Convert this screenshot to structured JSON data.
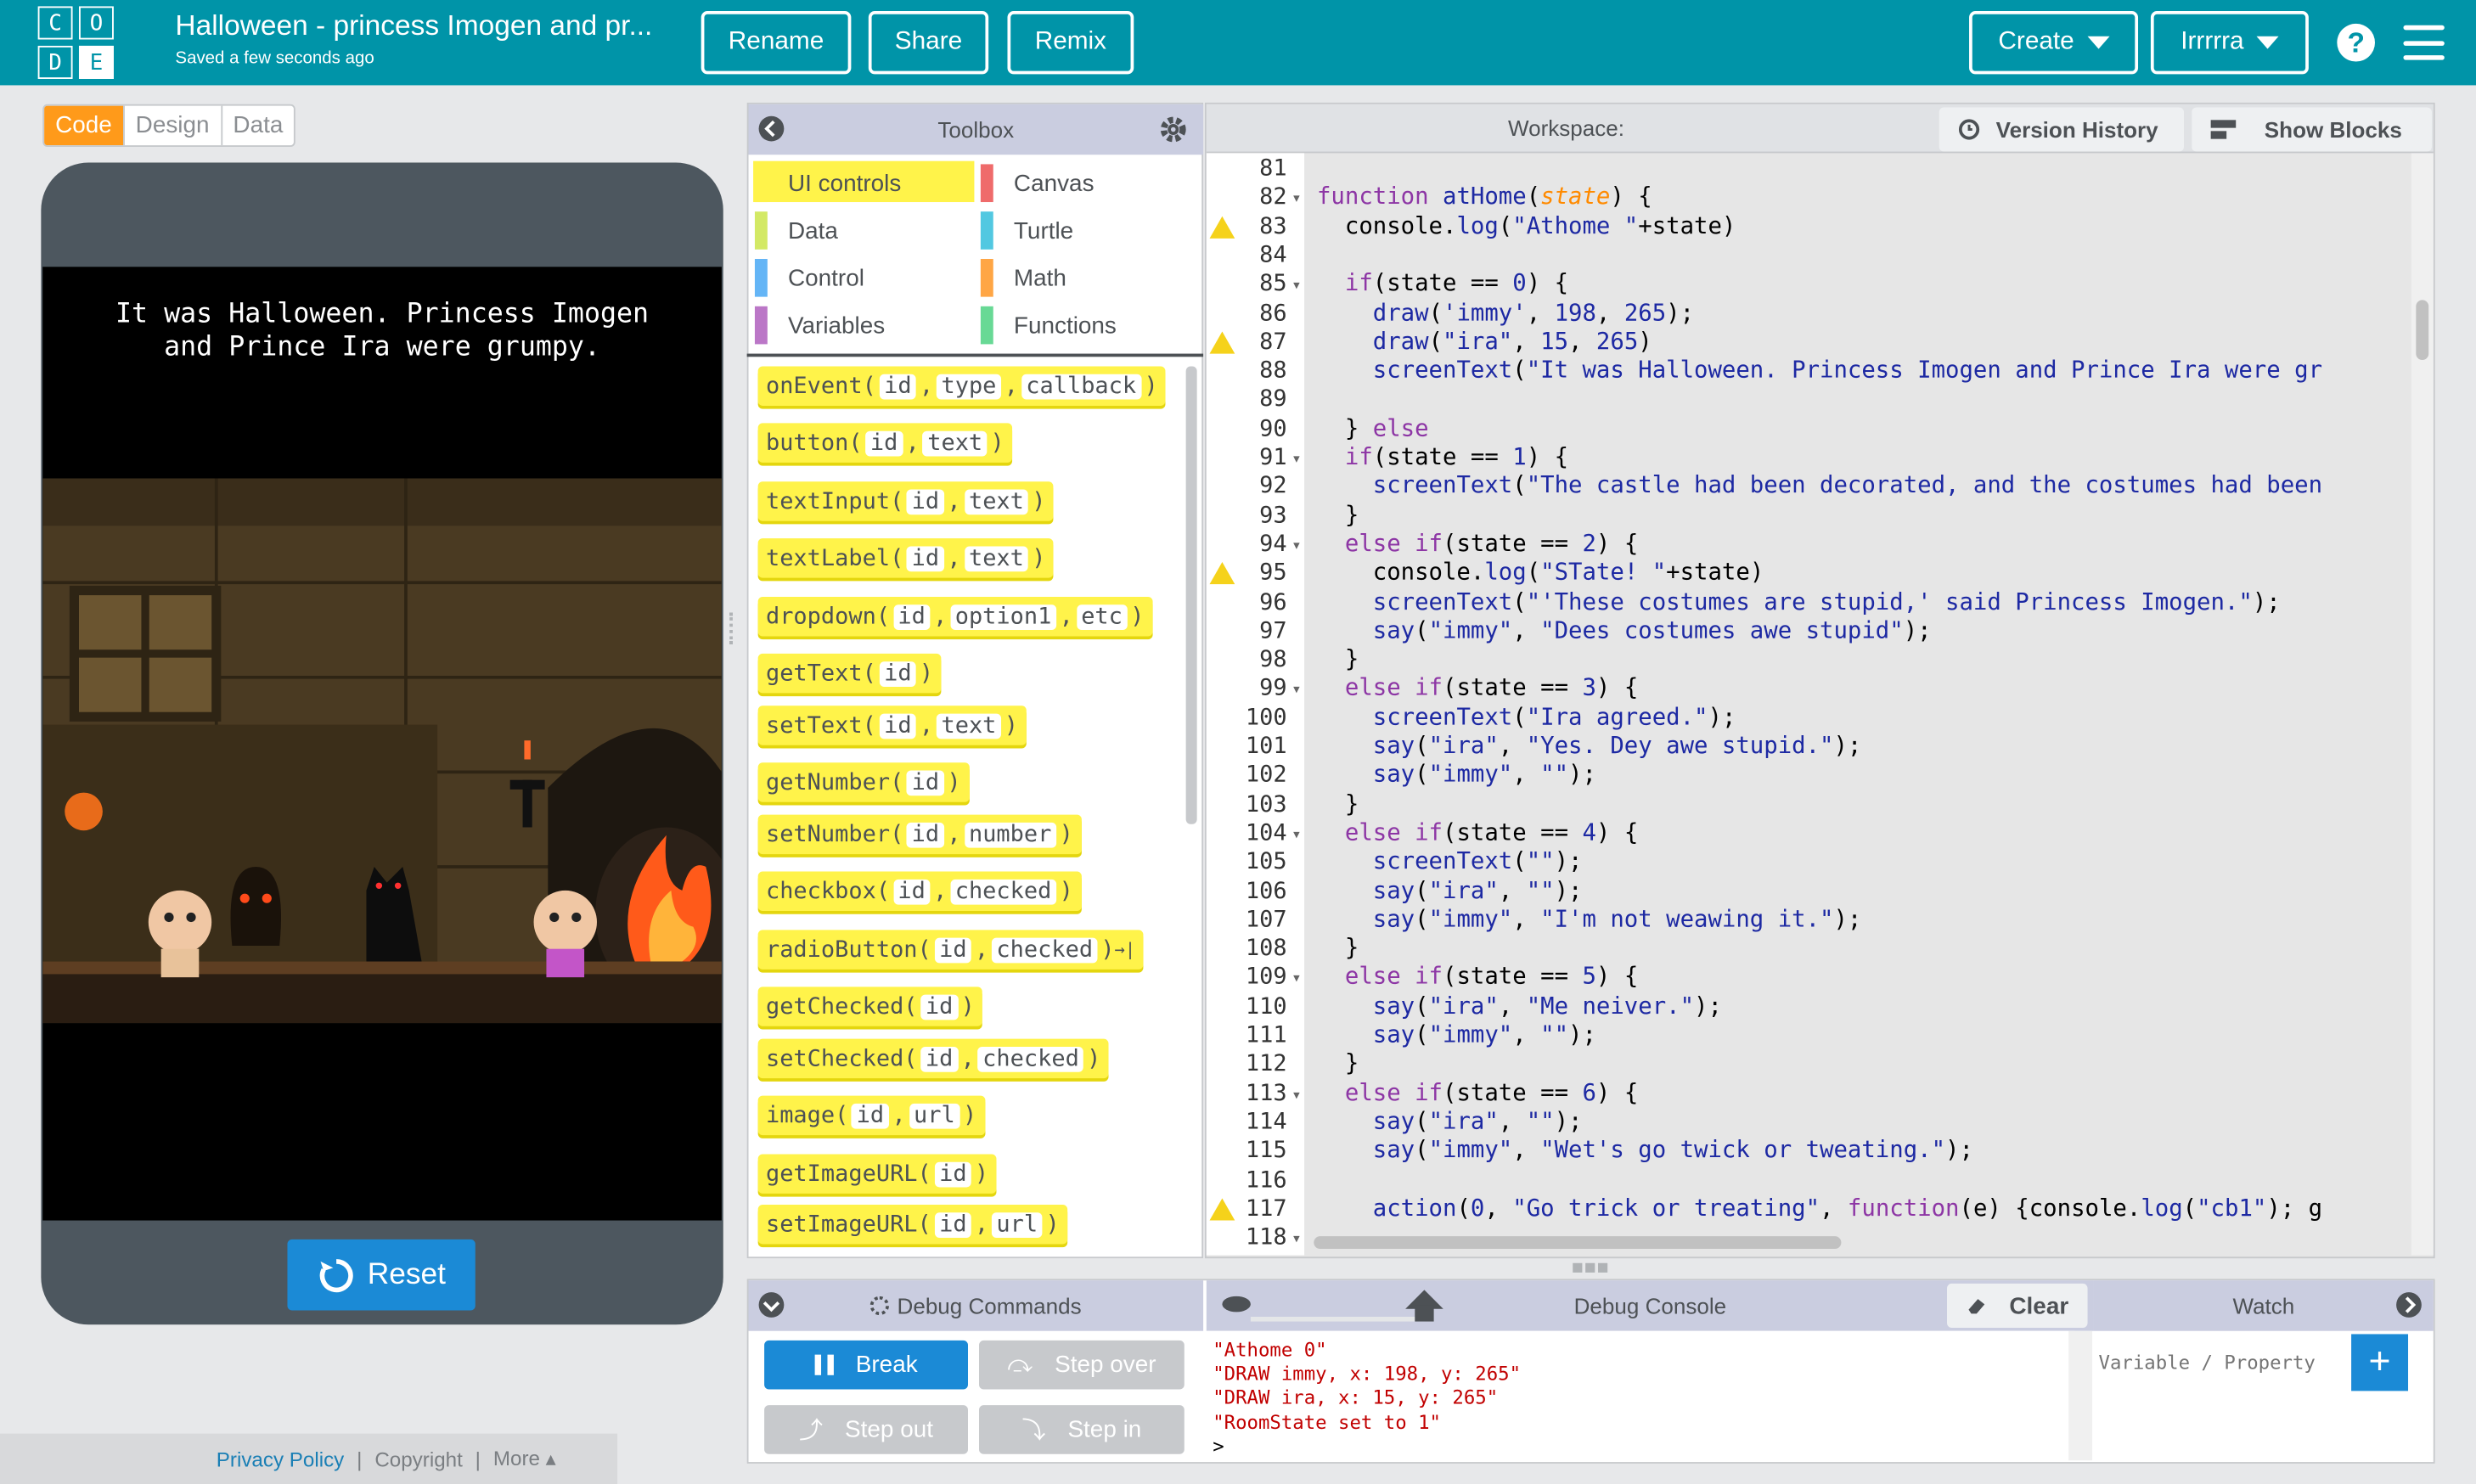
{
  "header": {
    "logo_letters": [
      "C",
      "O",
      "D",
      "E"
    ],
    "title": "Halloween - princess Imogen and pr...",
    "saved": "Saved a few seconds ago",
    "rename": "Rename",
    "share": "Share",
    "remix": "Remix",
    "create": "Create",
    "user": "Irrrrra",
    "help_icon": "?",
    "bg_color": "#0094a8"
  },
  "mode_tabs": [
    "Code",
    "Design",
    "Data"
  ],
  "app": {
    "screen_text": "It was Halloween. Princess Imogen\nand Prince Ira were grumpy.",
    "reset_label": "Reset"
  },
  "footer": {
    "privacy": "Privacy Policy",
    "sep1": "|",
    "copyright": "Copyright",
    "sep2": "|",
    "more": "More ▴"
  },
  "toolbox": {
    "title": "Toolbox",
    "categories": [
      {
        "label": "UI controls",
        "color": "#fff34a"
      },
      {
        "label": "Canvas",
        "color": "#ef6b6b"
      },
      {
        "label": "Data",
        "color": "#d3e965"
      },
      {
        "label": "Turtle",
        "color": "#52c8e1"
      },
      {
        "label": "Control",
        "color": "#64b5f6"
      },
      {
        "label": "Math",
        "color": "#ffa645"
      },
      {
        "label": "Variables",
        "color": "#bb77c7"
      },
      {
        "label": "Functions",
        "color": "#68d995"
      }
    ],
    "blocks": [
      {
        "name": "onEvent",
        "args": [
          "id",
          "type",
          "callback"
        ]
      },
      {
        "name": "button",
        "args": [
          "id",
          "text"
        ]
      },
      {
        "name": "textInput",
        "args": [
          "id",
          "text"
        ]
      },
      {
        "name": "textLabel",
        "args": [
          "id",
          "text"
        ]
      },
      {
        "name": "dropdown",
        "args": [
          "id",
          "option1",
          "etc"
        ]
      },
      {
        "name": "getText",
        "args": [
          "id"
        ]
      },
      {
        "name": "setText",
        "args": [
          "id",
          "text"
        ]
      },
      {
        "name": "getNumber",
        "args": [
          "id"
        ]
      },
      {
        "name": "setNumber",
        "args": [
          "id",
          "number"
        ]
      },
      {
        "name": "checkbox",
        "args": [
          "id",
          "checked"
        ]
      },
      {
        "name": "radioButton",
        "args": [
          "id",
          "checked"
        ]
      },
      {
        "name": "getChecked",
        "args": [
          "id"
        ]
      },
      {
        "name": "setChecked",
        "args": [
          "id",
          "checked"
        ]
      },
      {
        "name": "image",
        "args": [
          "id",
          "url"
        ]
      },
      {
        "name": "getImageURL",
        "args": [
          "id"
        ]
      },
      {
        "name": "setImageURL",
        "args": [
          "id",
          "url"
        ]
      }
    ]
  },
  "workspace": {
    "title": "Workspace:",
    "version_history": "Version History",
    "show_blocks": "Show Blocks",
    "lines": [
      {
        "n": 81,
        "t": ""
      },
      {
        "n": 82,
        "t": "function atHome(state) {",
        "fold": true
      },
      {
        "n": 83,
        "t": "  console.log(\"Athome \"+state)",
        "warn": true
      },
      {
        "n": 84,
        "t": ""
      },
      {
        "n": 85,
        "t": "  if(state == 0) {",
        "fold": true
      },
      {
        "n": 86,
        "t": "    draw('immy', 198, 265);"
      },
      {
        "n": 87,
        "t": "    draw(\"ira\", 15, 265)",
        "warn": true
      },
      {
        "n": 88,
        "t": "    screenText(\"It was Halloween. Princess Imogen and Prince Ira were gr"
      },
      {
        "n": 89,
        "t": ""
      },
      {
        "n": 90,
        "t": "  } else"
      },
      {
        "n": 91,
        "t": "  if(state == 1) {",
        "fold": true
      },
      {
        "n": 92,
        "t": "    screenText(\"The castle had been decorated, and the costumes had been"
      },
      {
        "n": 93,
        "t": "  }"
      },
      {
        "n": 94,
        "t": "  else if(state == 2) {",
        "fold": true
      },
      {
        "n": 95,
        "t": "    console.log(\"STate! \"+state)",
        "warn": true
      },
      {
        "n": 96,
        "t": "    screenText(\"'These costumes are stupid,' said Princess Imogen.\");"
      },
      {
        "n": 97,
        "t": "    say(\"immy\", \"Dees costumes awe stupid\");"
      },
      {
        "n": 98,
        "t": "  }"
      },
      {
        "n": 99,
        "t": "  else if(state == 3) {",
        "fold": true
      },
      {
        "n": 100,
        "t": "    screenText(\"Ira agreed.\");"
      },
      {
        "n": 101,
        "t": "    say(\"ira\", \"Yes. Dey awe stupid.\");"
      },
      {
        "n": 102,
        "t": "    say(\"immy\", \"\");"
      },
      {
        "n": 103,
        "t": "  }"
      },
      {
        "n": 104,
        "t": "  else if(state == 4) {",
        "fold": true
      },
      {
        "n": 105,
        "t": "    screenText(\"\");"
      },
      {
        "n": 106,
        "t": "    say(\"ira\", \"\");"
      },
      {
        "n": 107,
        "t": "    say(\"immy\", \"I'm not weawing it.\");"
      },
      {
        "n": 108,
        "t": "  }"
      },
      {
        "n": 109,
        "t": "  else if(state == 5) {",
        "fold": true
      },
      {
        "n": 110,
        "t": "    say(\"ira\", \"Me neiver.\");"
      },
      {
        "n": 111,
        "t": "    say(\"immy\", \"\");"
      },
      {
        "n": 112,
        "t": "  }"
      },
      {
        "n": 113,
        "t": "  else if(state == 6) {",
        "fold": true
      },
      {
        "n": 114,
        "t": "    say(\"ira\", \"\");"
      },
      {
        "n": 115,
        "t": "    say(\"immy\", \"Wet's go twick or tweating.\");"
      },
      {
        "n": 116,
        "t": ""
      },
      {
        "n": 117,
        "t": "    action(0, \"Go trick or treating\", function(e) {console.log(\"cb1\"); g",
        "warn": true
      },
      {
        "n": 118,
        "t": "",
        "fold": true
      }
    ]
  },
  "debug": {
    "commands_title": "Debug Commands",
    "break": "Break",
    "step_over": "Step over",
    "step_out": "Step out",
    "step_in": "Step in",
    "console_title": "Debug Console",
    "clear": "Clear",
    "console_lines": [
      "\"Athome 0\"",
      "\"DRAW immy, x: 198, y: 265\"",
      "\"DRAW ira, x: 15, y: 265\"",
      "\"RoomState set to 1\""
    ],
    "prompt": ">",
    "watch_title": "Watch",
    "watch_placeholder": "Variable / Property",
    "watch_add": "+"
  }
}
